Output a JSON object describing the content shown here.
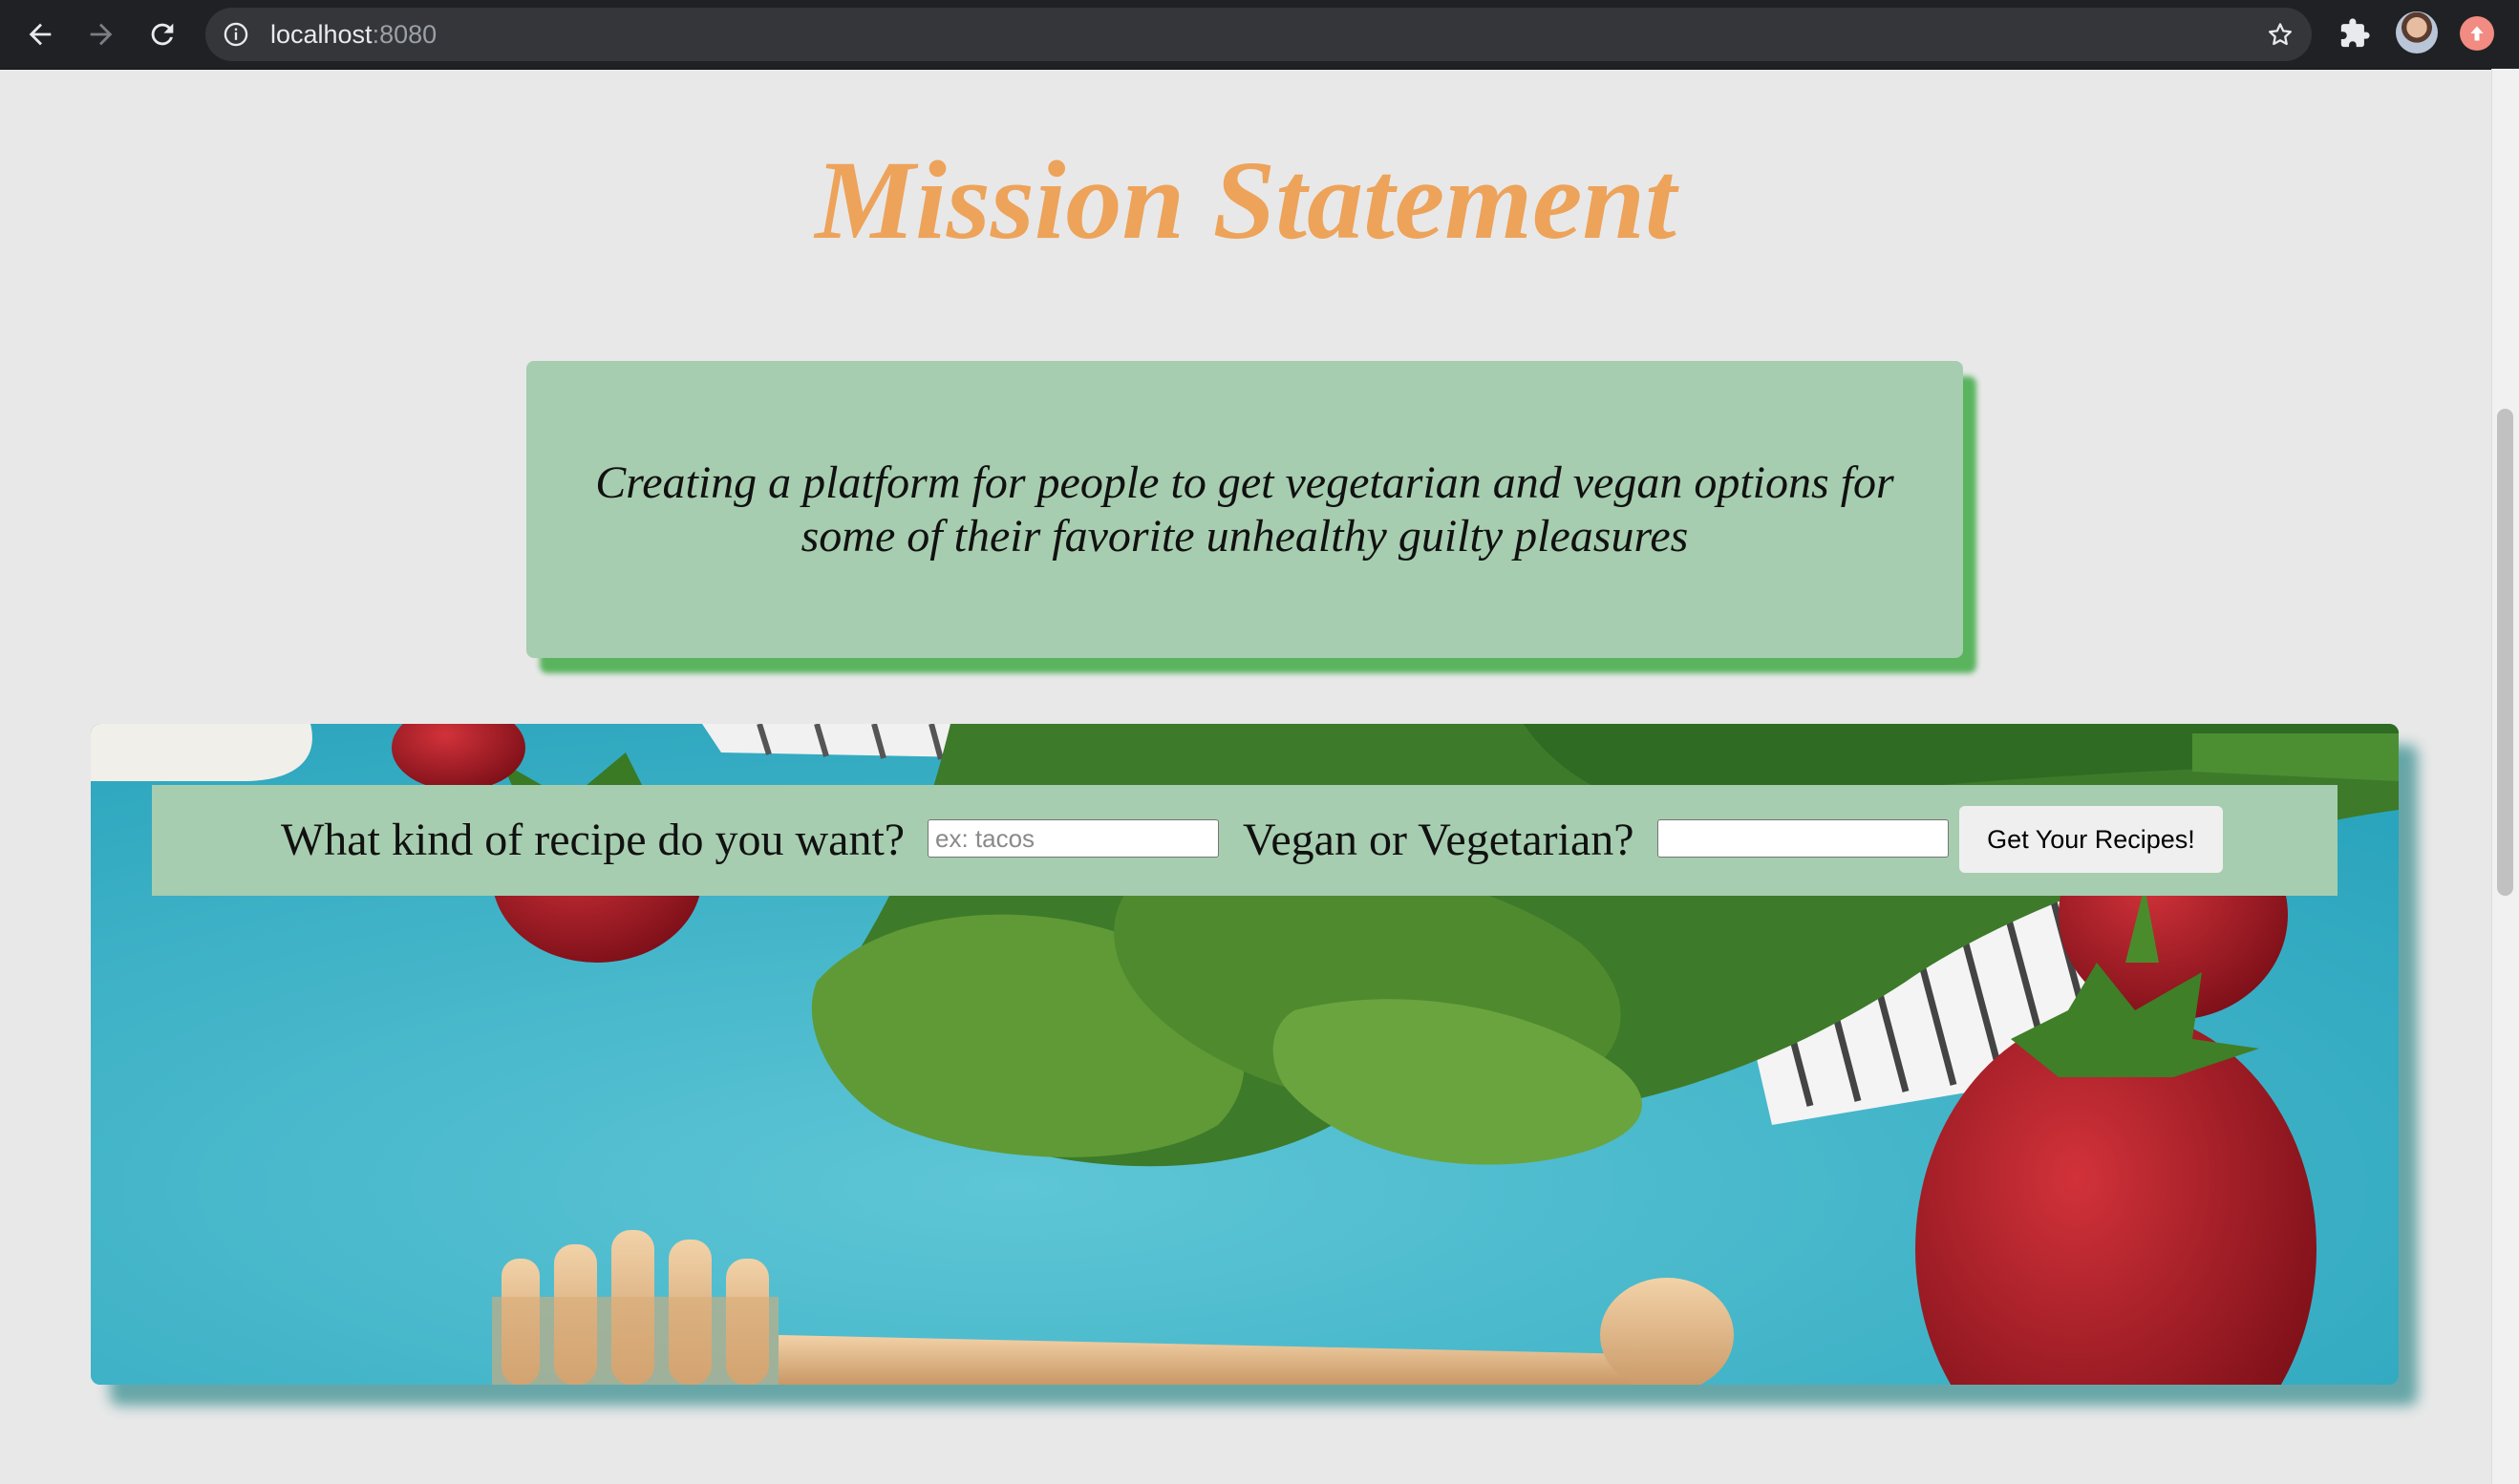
{
  "browser": {
    "url_host": "localhost",
    "url_port": ":8080",
    "back_icon": "arrow-left-icon",
    "forward_icon": "arrow-right-icon",
    "reload_icon": "reload-icon",
    "info_icon": "info-icon",
    "bookmark_icon": "star-icon",
    "extensions_icon": "puzzle-icon",
    "update_icon": "update-arrow-icon"
  },
  "page": {
    "title": "Mission Statement",
    "mission": "Creating a platform for people to get vegetarian and vegan options for some of their favorite unhealthy guilty pleasures"
  },
  "search": {
    "recipe_label": "What kind of recipe do you want?",
    "recipe_placeholder": "ex: tacos",
    "recipe_value": "",
    "diet_label": "Vegan or Vegetarian?",
    "diet_placeholder": "",
    "diet_value": "",
    "submit_label": "Get Your Recipes!"
  },
  "colors": {
    "title": "#eda35a",
    "card_bg": "#a6cdaf",
    "card_shadow": "#5ab45e",
    "hero_shadow": "#67a6a8"
  }
}
